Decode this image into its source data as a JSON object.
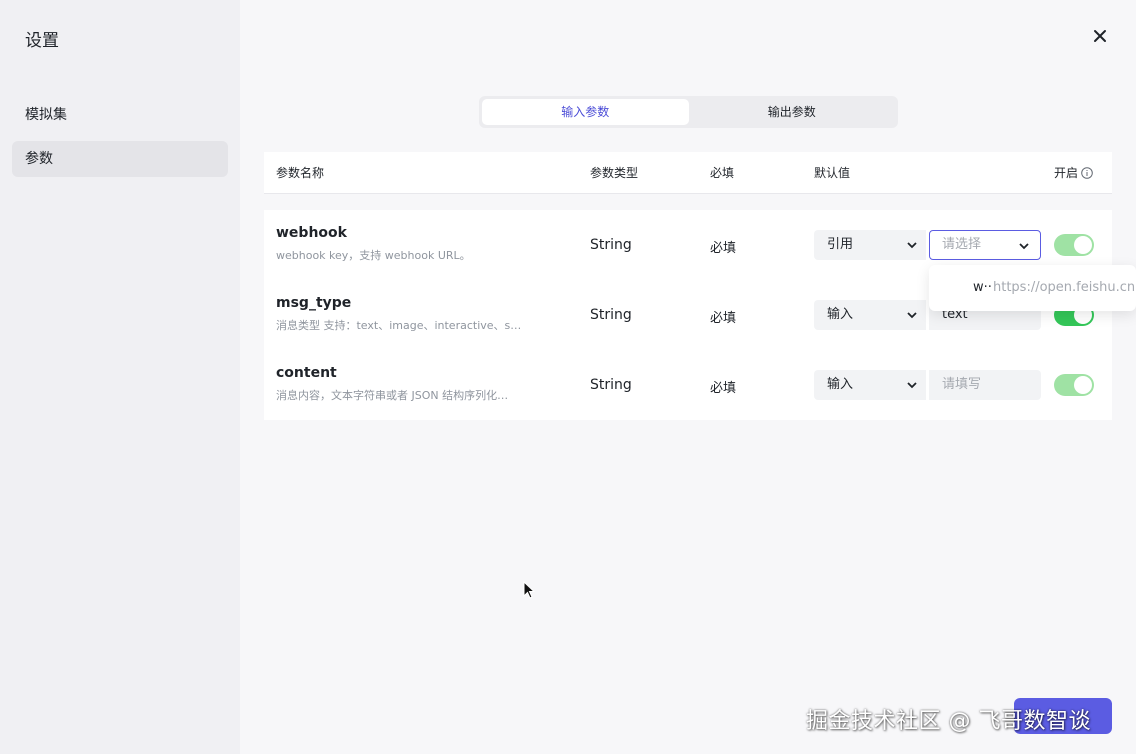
{
  "sidebar": {
    "title": "设置",
    "items": [
      {
        "label": "模拟集"
      },
      {
        "label": "参数"
      }
    ]
  },
  "tabs": [
    {
      "label": "输入参数",
      "active": true
    },
    {
      "label": "输出参数",
      "active": false
    }
  ],
  "table": {
    "headers": {
      "name": "参数名称",
      "type": "参数类型",
      "required": "必填",
      "default": "默认值",
      "enabled": "开启"
    },
    "rows": [
      {
        "name": "webhook",
        "desc": "webhook key，支持 webhook URL。",
        "type": "String",
        "required": "必填",
        "mode": "引用",
        "value": "请选择",
        "enabled": true
      },
      {
        "name": "msg_type",
        "desc": "消息类型 支持：text、image、interactive、s…",
        "type": "String",
        "required": "必填",
        "mode": "输入",
        "value": "text",
        "enabled": true
      },
      {
        "name": "content",
        "desc": "消息内容，文本字符串或者 JSON 结构序列化…",
        "type": "String",
        "required": "必填",
        "mode": "输入",
        "value": "请填写",
        "enabled": true
      }
    ]
  },
  "dropdown": {
    "option_key": "w··",
    "option_value": "https://open.feishu.cn"
  },
  "watermark": "掘金技术社区 @ 飞哥数智谈",
  "colors": {
    "accent": "#5b5ce2",
    "toggle_on": "#34c759",
    "toggle_on_dim": "#9fe2a4"
  }
}
